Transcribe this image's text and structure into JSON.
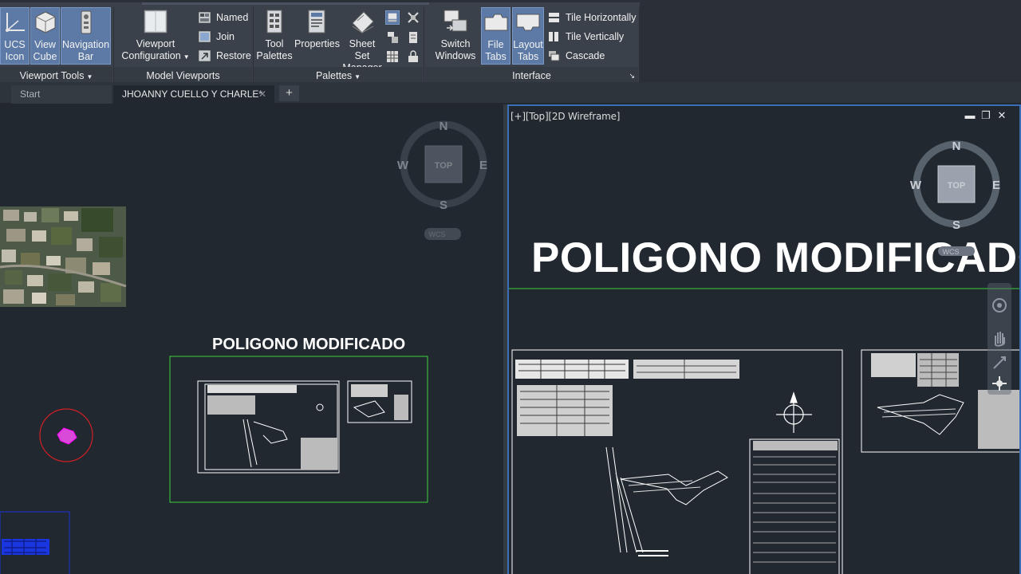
{
  "ribbon": {
    "viewport_tools": {
      "ucs_icon": "UCS\nIcon",
      "view_cube": "View\nCube",
      "navigation_bar": "Navigation\nBar",
      "panel_title": "Viewport Tools"
    },
    "model_viewports": {
      "viewport_configuration": "Viewport\nConfiguration",
      "named": "Named",
      "join": "Join",
      "restore": "Restore",
      "panel_title": "Model Viewports"
    },
    "palettes": {
      "tool_palettes": "Tool\nPalettes",
      "properties": "Properties",
      "sheet_set_manager": "Sheet Set\nManager",
      "panel_title": "Palettes"
    },
    "interface": {
      "switch_windows": "Switch\nWindows",
      "file_tabs": "File\nTabs",
      "layout_tabs": "Layout\nTabs",
      "tile_horizontally": "Tile Horizontally",
      "tile_vertically": "Tile Vertically",
      "cascade": "Cascade",
      "panel_title": "Interface"
    }
  },
  "file_tabs": {
    "start": "Start",
    "document": "JHOANNY CUELLO Y CHARLE*",
    "close_glyph": "✕",
    "new_tab_glyph": "+"
  },
  "viewport_right": {
    "label": "[+][Top][2D Wireframe]",
    "drawing_title": "POLIGONO MODIFICADO"
  },
  "viewport_left": {
    "drawing_title": "POLIGONO MODIFICADO"
  },
  "viewcube": {
    "north": "N",
    "south": "S",
    "east": "E",
    "west": "W",
    "face": "TOP",
    "ucs": "WCS"
  },
  "colors": {
    "active_button": "#5d7aa6",
    "viewport_bg": "#212830",
    "active_viewport_border": "#3a6fb8",
    "layout_frame": "#3bd13b",
    "marker_circle": "#d21f26"
  },
  "icons": [
    "ucs-icon",
    "view-cube-icon",
    "navigation-bar-icon",
    "viewport-configuration-icon",
    "named-icon",
    "join-icon",
    "restore-icon",
    "tool-palettes-icon",
    "properties-icon",
    "sheet-set-manager-icon",
    "switch-windows-icon",
    "file-tabs-icon",
    "layout-tabs-icon",
    "tile-horizontally-icon",
    "tile-vertically-icon",
    "cascade-icon",
    "compass-icon",
    "pan-icon",
    "orbit-icon",
    "steering-wheel-icon"
  ]
}
